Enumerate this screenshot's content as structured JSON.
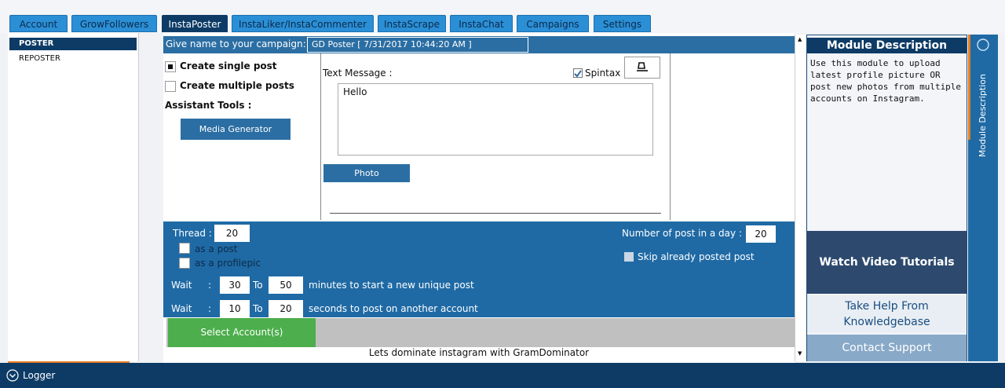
{
  "tabs": [
    "Account",
    "GrowFollowers",
    "InstaPoster",
    "InstaLiker/InstaCommenter",
    "InstaScrape",
    "InstaChat",
    "Campaigns",
    "Settings"
  ],
  "active_tab": "InstaPoster",
  "left_menu": [
    "POSTER",
    "REPOSTER"
  ],
  "campaign": {
    "name_label": "Give name to your campaign:",
    "name_value": "GD Poster [ 7/31/2017 10:44:20 AM ]"
  },
  "post_options": {
    "single": "Create single post",
    "multiple": "Create multiple posts",
    "assistant_tools": "Assistant Tools :",
    "media_generator": "Media Generator"
  },
  "text_message": {
    "label": "Text Message :",
    "spintax": "Spintax",
    "value": "Hello",
    "photo_button": "Photo"
  },
  "thread": {
    "label": "Thread :",
    "value": "20",
    "as_post": "as a post",
    "as_profilepic": "as a profilepic",
    "posts_per_day_label": "Number of post in a day :",
    "posts_per_day": "20",
    "skip_label": "Skip already posted post",
    "wait1_label": "Wait",
    "wait1_from": "30",
    "to_label": "To",
    "wait1_to": "50",
    "wait1_suffix": "minutes to start a new unique post",
    "wait2_label": "Wait",
    "wait2_from": "10",
    "wait2_to": "20",
    "wait2_suffix": "seconds to post on another account",
    "colon": ":"
  },
  "select_accounts": "Select Account(s)",
  "footer_message": "Lets dominate instagram with GramDominator",
  "right_panel": {
    "title": "Module Description",
    "description": "Use this module to upload latest profile picture OR post new photos from multiple accounts on Instagram.",
    "watch": "Watch Video Tutorials",
    "help": "Take Help From Knowledgebase",
    "support": "Contact Support",
    "vertical_label": "Module Description"
  },
  "logger": "Logger"
}
